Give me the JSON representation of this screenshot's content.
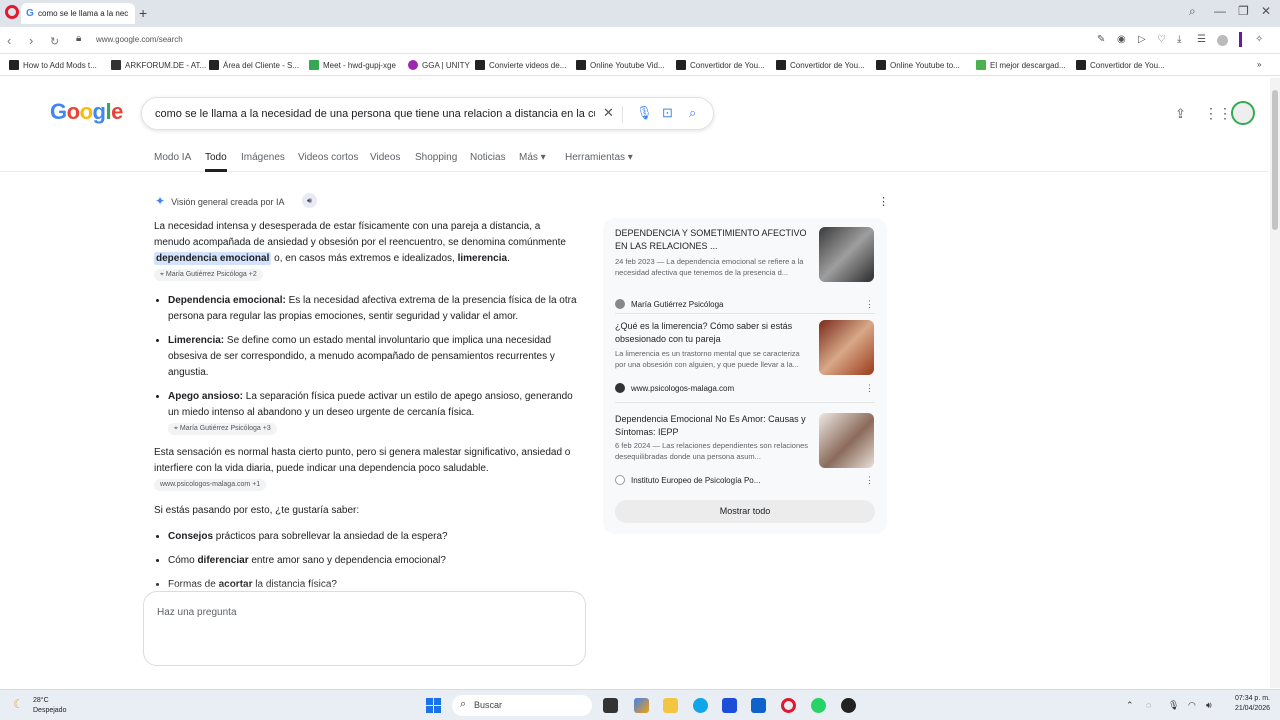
{
  "browser": {
    "tab_title": "como se le llama a la nece",
    "new_tab": "+",
    "url": "www.google.com/search",
    "bookmarks": [
      "How to Add Mods t...",
      "ARKFORUM.DE - AT...",
      "Área del Cliente - S...",
      "Meet - hwd-gupj-xge",
      "GGA | UNITY",
      "Convierte videos de...",
      "Online Youtube Vid...",
      "Convertidor de You...",
      "Convertidor de You...",
      "Online Youtube to...",
      "El mejor descargad...",
      "Convertidor de You..."
    ]
  },
  "search": {
    "query": "como se le llama a la necesidad de una persona que tiene una relacion a distancia en la cual"
  },
  "tabs": [
    "Modo IA",
    "Todo",
    "Imágenes",
    "Videos cortos",
    "Videos",
    "Shopping",
    "Noticias",
    "Más",
    "Herramientas"
  ],
  "ai_overview": {
    "header": "Visión general creada por IA",
    "intro_1": "La necesidad intensa y desesperada de estar físicamente con una pareja a distancia, a menudo acompañada de ansiedad y obsesión por el reencuentro, se denomina comúnmente",
    "intro_hl": "dependencia emocional",
    "intro_2": "o, en casos más extremos e idealizados,",
    "intro_bold": "limerencia",
    "intro_chip": "María Gutiérrez Psicóloga +2",
    "bullets": [
      {
        "term": "Dependencia emocional:",
        "text": "Es la necesidad afectiva extrema de la presencia física de la otra persona para regular las propias emociones, sentir seguridad y validar el amor.",
        "chip": ""
      },
      {
        "term": "Limerencia:",
        "text": "Se define como un estado mental involuntario que implica una necesidad obsesiva de ser correspondido, a menudo acompañado de pensamientos recurrentes y angustia.",
        "chip": ""
      },
      {
        "term": "Apego ansioso:",
        "text": "La separación física puede activar un estilo de apego ansioso, generando un miedo intenso al abandono y un deseo urgente de cercanía física.",
        "chip": "María Gutiérrez Psicóloga +3"
      }
    ],
    "para2": "Esta sensación es normal hasta cierto punto, pero si genera malestar significativo, ansiedad o interfiere con la vida diaria, puede indicar una dependencia poco saludable.",
    "para2_chip": "www.psicologos-malaga.com +1",
    "question": "Si estás pasando por esto, ¿te gustaría saber:",
    "followups": [
      {
        "bold": "Consejos",
        "rest": " prácticos para sobrellevar la ansiedad de la espera?"
      },
      {
        "pre": "Cómo ",
        "bold": "diferenciar",
        "rest": " entre amor sano y dependencia emocional?"
      },
      {
        "pre": "Formas de ",
        "bold": "acortar",
        "rest": " la distancia física?"
      }
    ],
    "ask_placeholder": "Haz una pregunta"
  },
  "sources": [
    {
      "title": "DEPENDENCIA Y SOMETIMIENTO AFECTIVO EN LAS RELACIONES ...",
      "snippet": "24 feb 2023 — La dependencia emocional se refiere a la necesidad afectiva que tenemos de la presencia d...",
      "source": "María Gutiérrez Psicóloga"
    },
    {
      "title": "¿Qué es la limerencia? Cómo saber si estás obsesionado con tu pareja",
      "snippet": "La limerencia es un trastorno mental que se caracteriza por una obsesión con alguien, y que puede llevar a la...",
      "source": "www.psicologos-malaga.com"
    },
    {
      "title": "Dependencia Emocional No Es Amor: Causas y Síntomas: IEPP",
      "snippet": "6 feb 2024 — Las relaciones dependientes son relaciones desequilibradas donde una persona asum...",
      "source": "Instituto Europeo de Psicología Po..."
    }
  ],
  "show_all": "Mostrar todo",
  "taskbar": {
    "temp": "28°C",
    "weather": "Despejado",
    "search": "Buscar",
    "time": "07:34 p. m.",
    "date": "21/04/2026"
  }
}
